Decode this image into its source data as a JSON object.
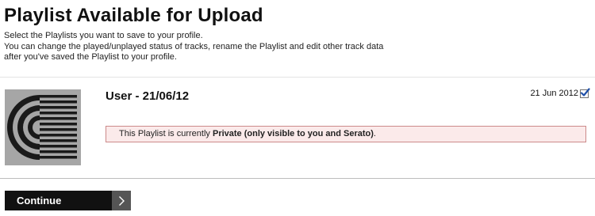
{
  "page": {
    "title": "Playlist Available for Upload",
    "intro_lines": [
      "Select the Playlists you want to save to your profile.",
      "You can change the played/unplayed status of tracks, rename the Playlist and edit other track data",
      "after you've saved the Playlist to your profile."
    ]
  },
  "playlist": {
    "name": "User - 21/06/12",
    "date": "21 Jun 2012",
    "selected": true,
    "artwork_icon": "serato-playlist-artwork",
    "privacy_prefix": "This Playlist is currently ",
    "privacy_status": "Private (only visible to you and Serato)",
    "privacy_suffix": "."
  },
  "actions": {
    "continue_label": "Continue",
    "continue_icon": "chevron-right-icon"
  },
  "colors": {
    "notice_background": "#fbeaea",
    "notice_border": "#cc8a8a",
    "button_background": "#111111",
    "button_arrow_background": "#555555",
    "checkbox_check": "#1f4fa8"
  }
}
